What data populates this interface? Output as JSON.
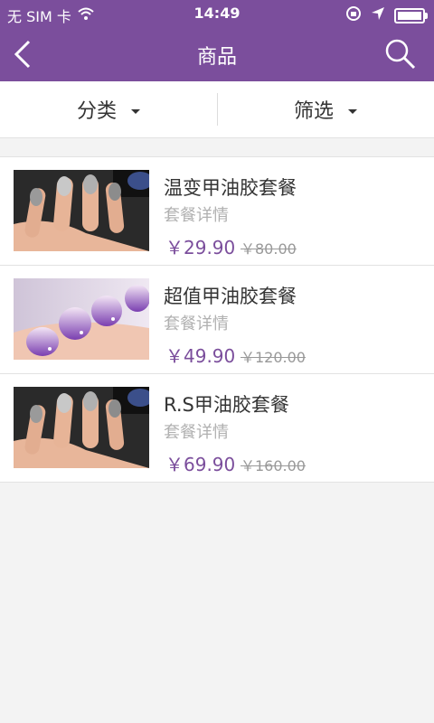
{
  "status_bar": {
    "carrier": "无 SIM 卡",
    "time": "14:49"
  },
  "header": {
    "title": "商品"
  },
  "filters": {
    "category": "分类",
    "filter": "筛选"
  },
  "products": [
    {
      "name": "温变甲油胶套餐",
      "detail": "套餐详情",
      "price": "￥29.90",
      "old_price": "￥80.00",
      "image": "chrome-nails"
    },
    {
      "name": "超值甲油胶套餐",
      "detail": "套餐详情",
      "price": "￥49.90",
      "old_price": "￥120.00",
      "image": "purple-glitter-nails"
    },
    {
      "name": "R.S甲油胶套餐",
      "detail": "套餐详情",
      "price": "￥69.90",
      "old_price": "￥160.00",
      "image": "chrome-nails"
    }
  ],
  "colors": {
    "header": "#7b4e9c",
    "price": "#7b4e9c",
    "background": "#f3f3f3"
  }
}
